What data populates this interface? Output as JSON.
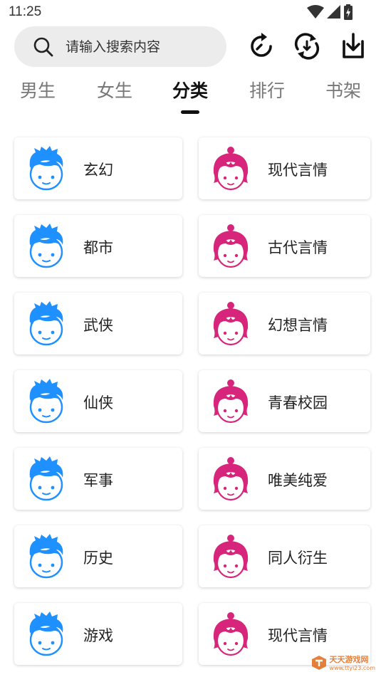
{
  "status": {
    "time": "11:25"
  },
  "search": {
    "placeholder": "请输入搜索内容"
  },
  "tabs": [
    {
      "label": "男生",
      "active": false
    },
    {
      "label": "女生",
      "active": false
    },
    {
      "label": "分类",
      "active": true
    },
    {
      "label": "排行",
      "active": false
    },
    {
      "label": "书架",
      "active": false
    }
  ],
  "categories": {
    "male": [
      "玄幻",
      "都市",
      "武侠",
      "仙侠",
      "军事",
      "历史",
      "游戏"
    ],
    "female": [
      "现代言情",
      "古代言情",
      "幻想言情",
      "青春校园",
      "唯美纯爱",
      "同人衍生",
      "现代言情"
    ]
  },
  "colors": {
    "male_avatar": "#1e90ff",
    "female_avatar": "#d6257a",
    "active_tab": "#111111",
    "inactive_tab": "#777777"
  },
  "watermark": {
    "title": "天天游戏网",
    "sub": "www.ttyi23.com"
  }
}
